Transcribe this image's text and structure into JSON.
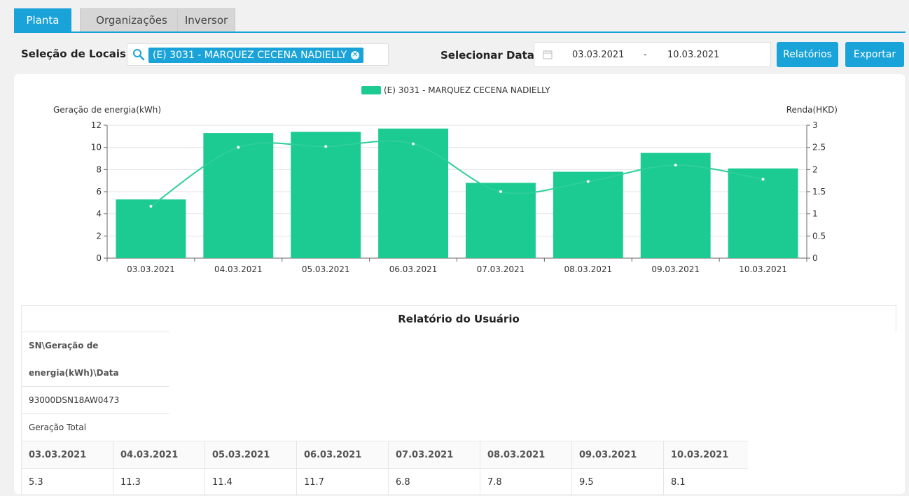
{
  "tabs": [
    {
      "label": "Planta",
      "active": true
    },
    {
      "label": "Organizações",
      "active": false
    },
    {
      "label": "Inversor",
      "active": false
    }
  ],
  "toolbar": {
    "site_label": "Seleção de Locais",
    "site_tag": "(E) 3031 - MARQUEZ CECENA NADIELLY",
    "date_label": "Selecionar Data",
    "date_start": "03.03.2021",
    "date_sep": "-",
    "date_end": "10.03.2021",
    "reports_button": "Relatórios",
    "export_button": "Exportar"
  },
  "colors": {
    "accent": "#1aa3d8",
    "series": "#1ccb92"
  },
  "chart_data": {
    "type": "bar",
    "legend": "(E) 3031 - MARQUEZ CECENA NADIELLY",
    "ylabel_left": "Geração de energia(kWh)",
    "ylabel_right": "Renda(HKD)",
    "ylim_left": [
      0,
      12
    ],
    "ylim_right": [
      0,
      3
    ],
    "yticks_left": [
      "0",
      "2",
      "4",
      "6",
      "8",
      "10",
      "12"
    ],
    "yticks_right": [
      "0",
      "0.5",
      "1",
      "1.5",
      "2",
      "2.5",
      "3"
    ],
    "categories": [
      "03.03.2021",
      "04.03.2021",
      "05.03.2021",
      "06.03.2021",
      "07.03.2021",
      "08.03.2021",
      "09.03.2021",
      "10.03.2021"
    ],
    "series": [
      {
        "name": "(E) 3031 - MARQUEZ CECENA NADIELLY",
        "axis": "left",
        "type": "bar",
        "values": [
          5.3,
          11.3,
          11.4,
          11.7,
          6.8,
          7.8,
          9.5,
          8.1
        ]
      },
      {
        "axis": "right",
        "type": "line",
        "values": [
          1.17,
          2.5,
          2.52,
          2.58,
          1.5,
          1.73,
          2.1,
          1.78
        ]
      }
    ]
  },
  "report": {
    "title": "Relatório do Usuário",
    "header_line1": "SN\\Geração de",
    "header_line2": "energia(kWh)\\Data",
    "sn": "93000DSN18AW0473",
    "total_label": "Geração Total",
    "dates": [
      "03.03.2021",
      "04.03.2021",
      "05.03.2021",
      "06.03.2021",
      "07.03.2021",
      "08.03.2021",
      "09.03.2021",
      "10.03.2021"
    ],
    "values": [
      "5.3",
      "11.3",
      "11.4",
      "11.7",
      "6.8",
      "7.8",
      "9.5",
      "8.1"
    ]
  }
}
